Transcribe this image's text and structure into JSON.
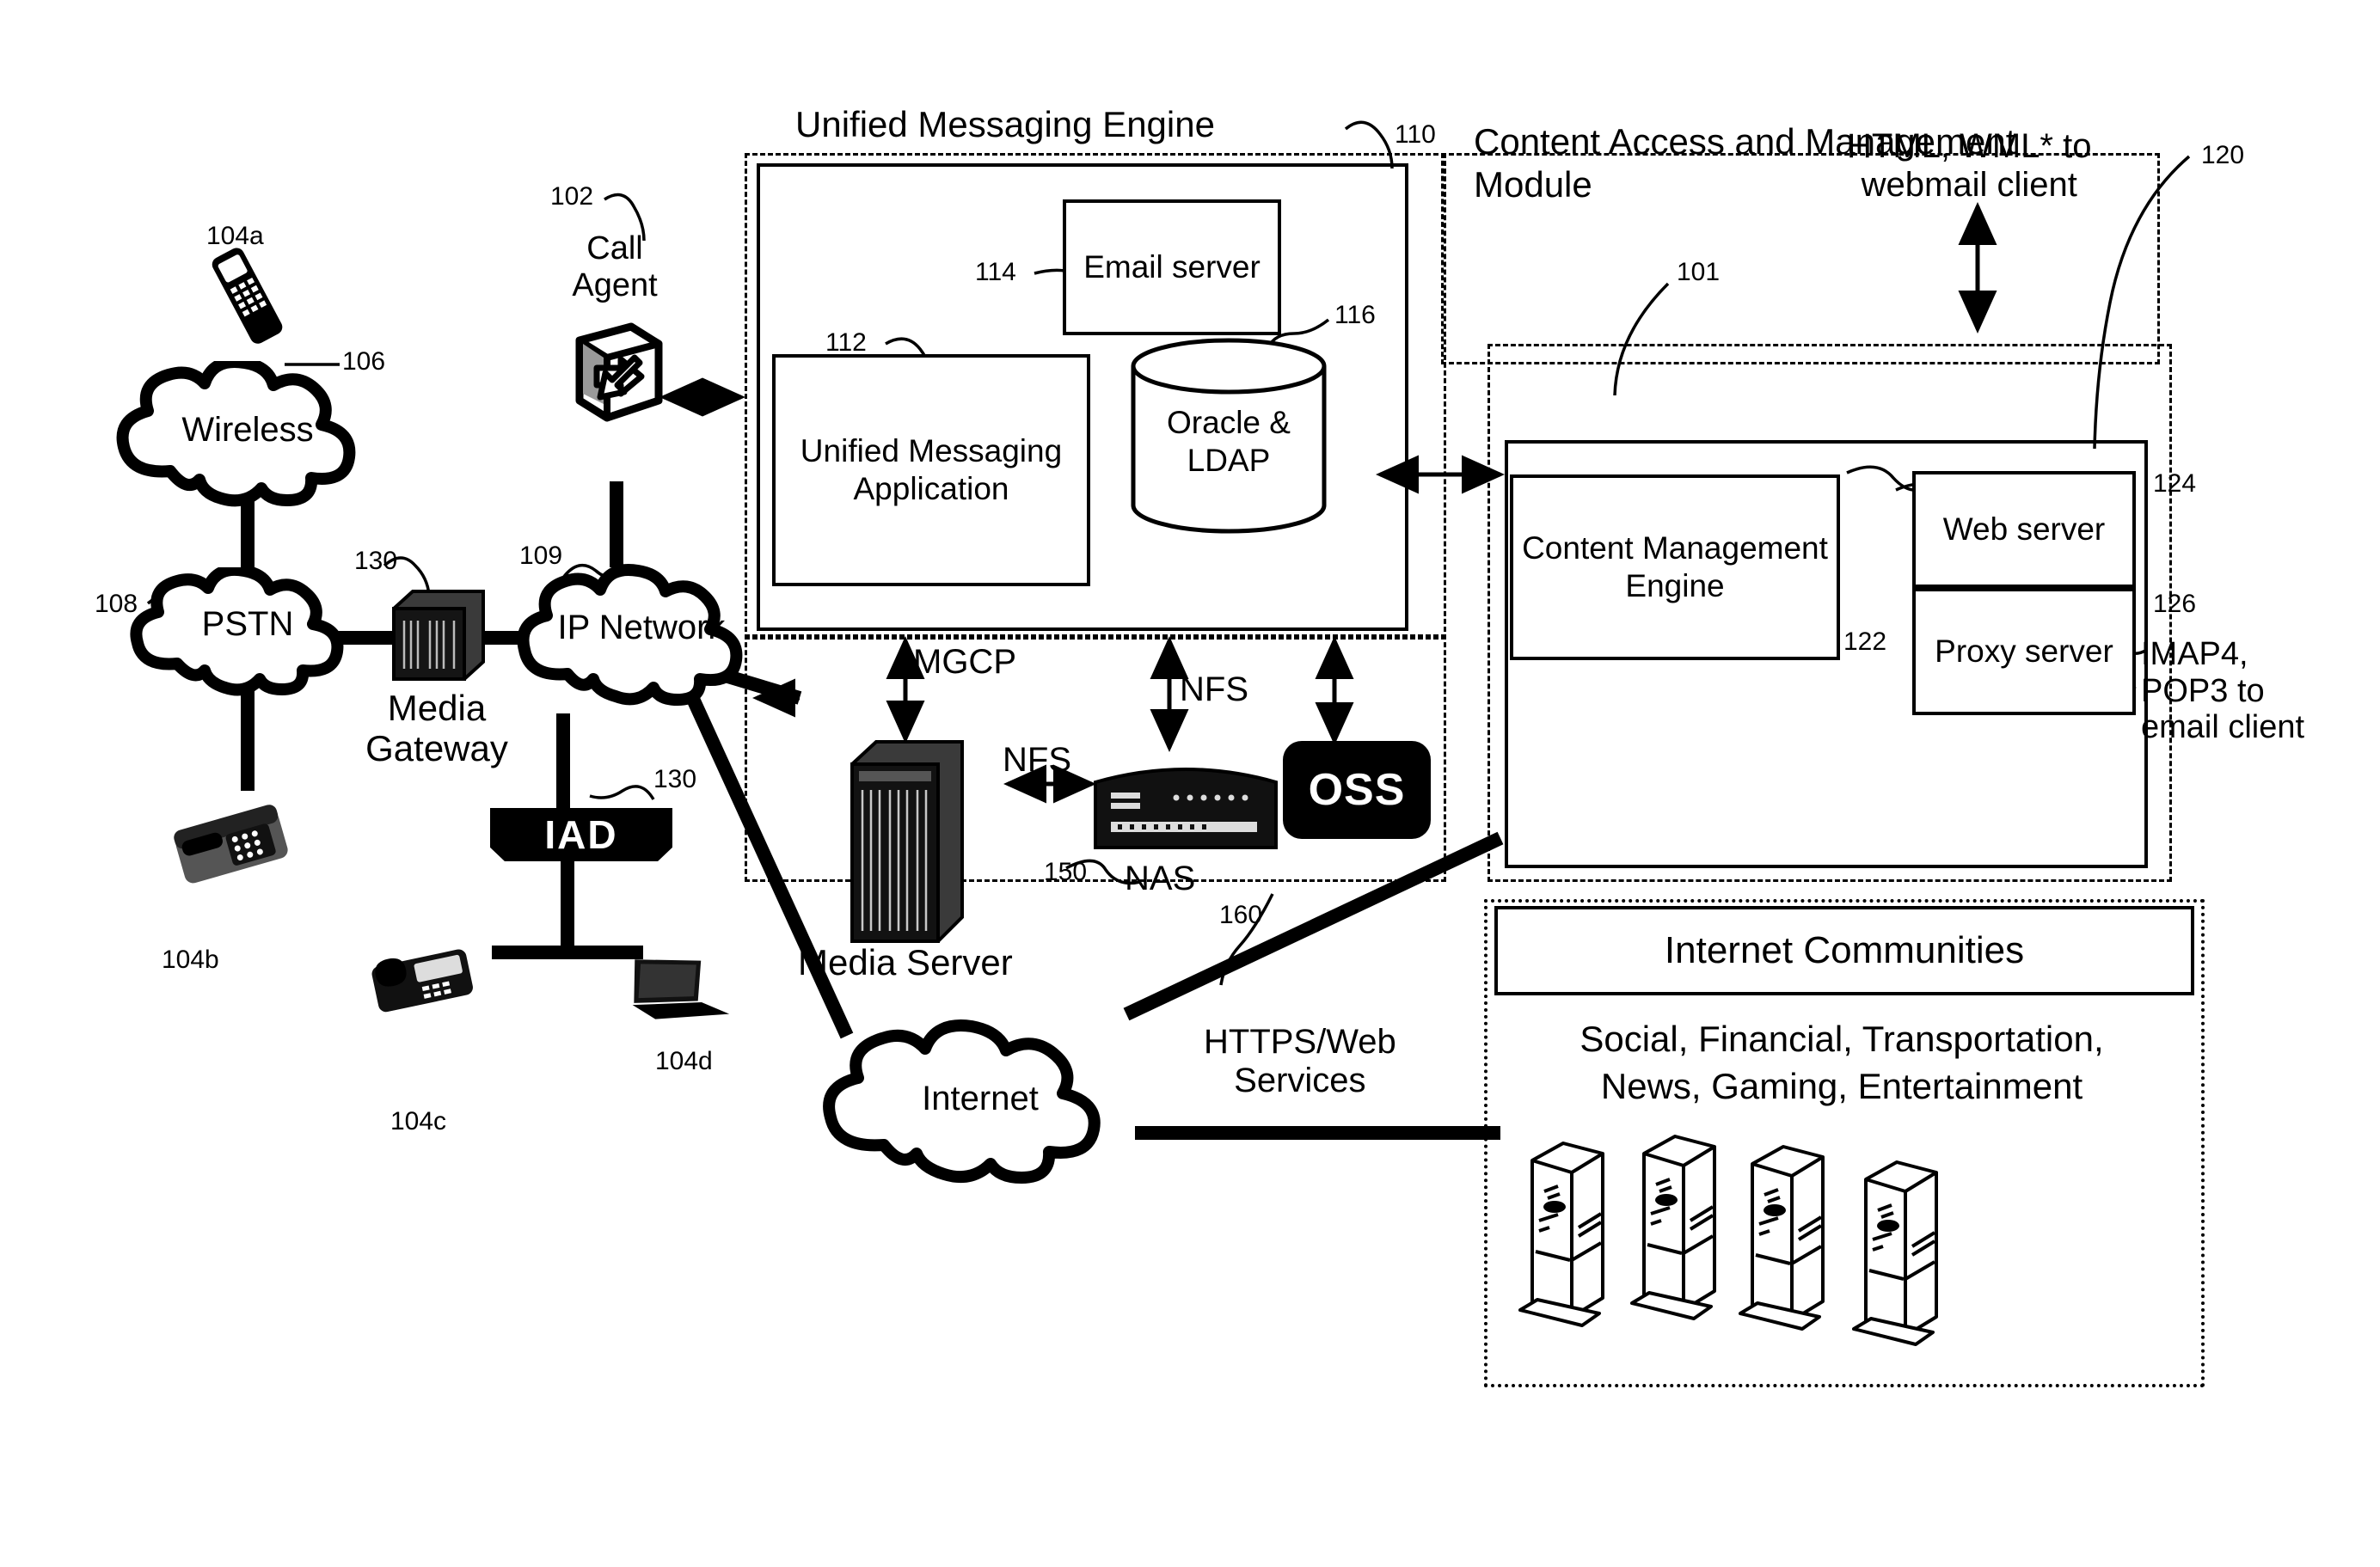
{
  "diagram": {
    "titles": {
      "unified_messaging_engine": "Unified Messaging Engine",
      "content_access_module": "Content Access and Management\nModule",
      "internet_communities": "Internet Communities"
    },
    "refs": {
      "r101": "101",
      "r102": "102",
      "r104a": "104a",
      "r104b": "104b",
      "r104c": "104c",
      "r104d": "104d",
      "r106": "106",
      "r108": "108",
      "r109": "109",
      "r110": "110",
      "r112": "112",
      "r114": "114",
      "r116": "116",
      "r120": "120",
      "r122": "122",
      "r124": "124",
      "r126": "126",
      "r130_gateway": "130",
      "r130_iad": "130",
      "r150": "150",
      "r160": "160"
    },
    "boxes": {
      "email_server": "Email\nserver",
      "unified_messaging_application": "Unified\nMessaging\nApplication",
      "oracle_ldap": "Oracle\n& LDAP",
      "content_management_engine": "Content\nManagement\nEngine",
      "web_server": "Web\nserver",
      "proxy_server": "Proxy\nserver",
      "oss": "OSS",
      "iad": "IAD"
    },
    "clouds": {
      "wireless": "Wireless",
      "pstn": "PSTN",
      "ip_network": "IP Network",
      "internet": "Internet"
    },
    "device_labels": {
      "media_gateway": "Media\nGateway",
      "media_server": "Media Server",
      "nas": "NAS"
    },
    "protocol_labels": {
      "mgcp": "MGCP",
      "nfs_vertical": "NFS",
      "nfs_horizontal": "NFS",
      "html_wml": "HTML, WML* to\nwebmail client",
      "imap_pop": "IMAP4,\nPOP3 to\nemail client",
      "https_web": "HTTPS/Web\nServices"
    },
    "communities": {
      "categories": "Social, Financial, Transportation,\nNews, Gaming, Entertainment"
    },
    "colors": {
      "line": "#000000",
      "background": "#ffffff",
      "fill_dark": "#000000"
    }
  }
}
